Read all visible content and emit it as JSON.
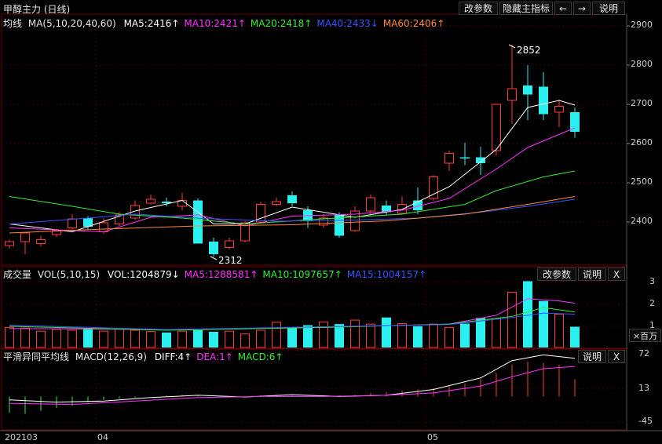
{
  "title": "甲醇主力 (日线)",
  "toolbar": {
    "params": "改参数",
    "hide_indicator": "隐藏主指标",
    "prev": "←",
    "next": "→",
    "help": "说明"
  },
  "panels": {
    "main": {
      "label": "均线",
      "formula": "MA(5,10,20,40,60)",
      "items": [
        {
          "text": "MA5:2416↑",
          "color": "#ffffff"
        },
        {
          "text": "MA10:2421↑",
          "color": "#ff33ff"
        },
        {
          "text": "MA20:2418↑",
          "color": "#33ee33"
        },
        {
          "text": "MA40:2433↓",
          "color": "#3355ff"
        },
        {
          "text": "MA60:2406↑",
          "color": "#ff8833"
        }
      ]
    },
    "volume": {
      "label": "成交量",
      "formula": "VOL(5,10,15)",
      "items": [
        {
          "text": "VOL:1204879↓",
          "color": "#ffffff"
        },
        {
          "text": "MA5:1288581↑",
          "color": "#ff33ff"
        },
        {
          "text": "MA10:1097657↑",
          "color": "#33ee33"
        },
        {
          "text": "MA15:1004157↑",
          "color": "#3355ff"
        }
      ],
      "params": "改参数",
      "help": "说明",
      "close": "X",
      "unit": "×百万"
    },
    "macd": {
      "label": "平滑异同平均线",
      "formula": "MACD(12,26,9)",
      "items": [
        {
          "text": "DIFF:4↑",
          "color": "#ffffff"
        },
        {
          "text": "DEA:1↑",
          "color": "#ff33ff"
        },
        {
          "text": "MACD:6↑",
          "color": "#33ee33"
        }
      ],
      "help": "说明",
      "close": "X"
    }
  },
  "chart_data": {
    "type": "candlestick",
    "title": "甲醇主力 (日线)",
    "price_axis": {
      "ticks": [
        2900,
        2800,
        2700,
        2600,
        2500,
        2400
      ]
    },
    "volume_axis": {
      "ticks": [
        3,
        2,
        1
      ],
      "unit": "×百万"
    },
    "macd_axis": {
      "ticks": [
        72,
        13,
        -45
      ]
    },
    "x_labels": [
      {
        "text": "202103",
        "index": 0
      },
      {
        "text": "04",
        "index": 6
      },
      {
        "text": "05",
        "index": 27
      }
    ],
    "annotations": [
      {
        "text": "2852",
        "index": 32,
        "value": 2852
      },
      {
        "text": "2312",
        "index": 13,
        "value": 2312
      }
    ],
    "candles": [
      {
        "o": 2340,
        "h": 2355,
        "l": 2332,
        "c": 2350
      },
      {
        "o": 2350,
        "h": 2375,
        "l": 2318,
        "c": 2372
      },
      {
        "o": 2345,
        "h": 2365,
        "l": 2338,
        "c": 2355
      },
      {
        "o": 2368,
        "h": 2382,
        "l": 2362,
        "c": 2378
      },
      {
        "o": 2385,
        "h": 2420,
        "l": 2380,
        "c": 2408
      },
      {
        "o": 2410,
        "h": 2415,
        "l": 2380,
        "c": 2388
      },
      {
        "o": 2375,
        "h": 2410,
        "l": 2370,
        "c": 2398
      },
      {
        "o": 2395,
        "h": 2425,
        "l": 2390,
        "c": 2418
      },
      {
        "o": 2410,
        "h": 2455,
        "l": 2405,
        "c": 2442
      },
      {
        "o": 2448,
        "h": 2470,
        "l": 2445,
        "c": 2458
      },
      {
        "o": 2452,
        "h": 2462,
        "l": 2440,
        "c": 2448
      },
      {
        "o": 2440,
        "h": 2475,
        "l": 2430,
        "c": 2455
      },
      {
        "o": 2455,
        "h": 2460,
        "l": 2345,
        "c": 2345
      },
      {
        "o": 2350,
        "h": 2360,
        "l": 2312,
        "c": 2318
      },
      {
        "o": 2335,
        "h": 2360,
        "l": 2330,
        "c": 2352
      },
      {
        "o": 2352,
        "h": 2402,
        "l": 2348,
        "c": 2398
      },
      {
        "o": 2400,
        "h": 2452,
        "l": 2395,
        "c": 2445
      },
      {
        "o": 2445,
        "h": 2462,
        "l": 2440,
        "c": 2452
      },
      {
        "o": 2468,
        "h": 2478,
        "l": 2440,
        "c": 2448
      },
      {
        "o": 2430,
        "h": 2440,
        "l": 2385,
        "c": 2402
      },
      {
        "o": 2392,
        "h": 2420,
        "l": 2385,
        "c": 2410
      },
      {
        "o": 2418,
        "h": 2425,
        "l": 2360,
        "c": 2365
      },
      {
        "o": 2378,
        "h": 2440,
        "l": 2375,
        "c": 2428
      },
      {
        "o": 2428,
        "h": 2470,
        "l": 2420,
        "c": 2462
      },
      {
        "o": 2442,
        "h": 2455,
        "l": 2418,
        "c": 2425
      },
      {
        "o": 2422,
        "h": 2465,
        "l": 2420,
        "c": 2445
      },
      {
        "o": 2455,
        "h": 2488,
        "l": 2420,
        "c": 2430
      },
      {
        "o": 2460,
        "h": 2520,
        "l": 2455,
        "c": 2515
      },
      {
        "o": 2550,
        "h": 2582,
        "l": 2530,
        "c": 2575
      },
      {
        "o": 2565,
        "h": 2602,
        "l": 2545,
        "c": 2562
      },
      {
        "o": 2565,
        "h": 2592,
        "l": 2520,
        "c": 2550
      },
      {
        "o": 2582,
        "h": 2702,
        "l": 2570,
        "c": 2700
      },
      {
        "o": 2710,
        "h": 2852,
        "l": 2650,
        "c": 2740
      },
      {
        "o": 2748,
        "h": 2800,
        "l": 2660,
        "c": 2725
      },
      {
        "o": 2745,
        "h": 2782,
        "l": 2660,
        "c": 2675
      },
      {
        "o": 2680,
        "h": 2712,
        "l": 2642,
        "c": 2695
      },
      {
        "o": 2680,
        "h": 2692,
        "l": 2615,
        "c": 2630
      }
    ],
    "ma": [
      {
        "name": "MA5",
        "color": "#ffffff",
        "points": [
          [
            0,
            2395
          ],
          [
            4,
            2375
          ],
          [
            8,
            2428
          ],
          [
            11,
            2455
          ],
          [
            13,
            2395
          ],
          [
            15,
            2395
          ],
          [
            18,
            2438
          ],
          [
            22,
            2412
          ],
          [
            25,
            2432
          ],
          [
            28,
            2490
          ],
          [
            31,
            2585
          ],
          [
            33,
            2692
          ],
          [
            35,
            2710
          ],
          [
            36,
            2698
          ]
        ]
      },
      {
        "name": "MA10",
        "color": "#ff33ff",
        "points": [
          [
            0,
            2385
          ],
          [
            6,
            2375
          ],
          [
            9,
            2412
          ],
          [
            12,
            2418
          ],
          [
            15,
            2390
          ],
          [
            18,
            2415
          ],
          [
            22,
            2420
          ],
          [
            25,
            2430
          ],
          [
            28,
            2460
          ],
          [
            31,
            2535
          ],
          [
            33,
            2590
          ],
          [
            36,
            2640
          ]
        ]
      },
      {
        "name": "MA20",
        "color": "#33ee33",
        "points": [
          [
            0,
            2465
          ],
          [
            4,
            2440
          ],
          [
            7,
            2420
          ],
          [
            11,
            2410
          ],
          [
            15,
            2395
          ],
          [
            20,
            2408
          ],
          [
            25,
            2420
          ],
          [
            29,
            2445
          ],
          [
            31,
            2480
          ],
          [
            34,
            2515
          ],
          [
            36,
            2530
          ]
        ]
      },
      {
        "name": "MA40",
        "color": "#3355ff",
        "points": [
          [
            0,
            2395
          ],
          [
            5,
            2410
          ],
          [
            8,
            2420
          ],
          [
            12,
            2410
          ],
          [
            17,
            2402
          ],
          [
            22,
            2405
          ],
          [
            26,
            2410
          ],
          [
            30,
            2425
          ],
          [
            33,
            2440
          ],
          [
            36,
            2458
          ]
        ]
      },
      {
        "name": "MA60",
        "color": "#ff8833",
        "points": [
          [
            0,
            2372
          ],
          [
            6,
            2382
          ],
          [
            12,
            2390
          ],
          [
            18,
            2393
          ],
          [
            24,
            2403
          ],
          [
            29,
            2420
          ],
          [
            33,
            2445
          ],
          [
            36,
            2465
          ]
        ]
      }
    ],
    "volume": [
      0.95,
      0.92,
      0.78,
      0.86,
      0.82,
      0.88,
      0.78,
      0.88,
      0.82,
      0.76,
      0.72,
      0.78,
      0.82,
      0.75,
      0.78,
      0.65,
      0.82,
      1.18,
      0.92,
      1.05,
      1.2,
      1.1,
      1.28,
      1.1,
      1.4,
      1.12,
      1.0,
      1.1,
      0.95,
      1.12,
      1.38,
      1.35,
      2.55,
      3.05,
      2.15,
      1.55,
      0.98
    ],
    "volume_ma": [
      {
        "name": "MA5",
        "color": "#ff33ff",
        "points": [
          [
            0,
            0.9
          ],
          [
            10,
            0.85
          ],
          [
            20,
            0.95
          ],
          [
            28,
            1.1
          ],
          [
            31,
            1.5
          ],
          [
            33,
            2.25
          ],
          [
            35,
            2.15
          ],
          [
            36,
            2.05
          ]
        ]
      },
      {
        "name": "MA10",
        "color": "#33ee33",
        "points": [
          [
            0,
            1.0
          ],
          [
            10,
            0.82
          ],
          [
            20,
            0.95
          ],
          [
            28,
            1.1
          ],
          [
            32,
            1.45
          ],
          [
            34,
            1.85
          ],
          [
            36,
            1.65
          ]
        ]
      },
      {
        "name": "MA15",
        "color": "#3355ff",
        "points": [
          [
            0,
            1.05
          ],
          [
            10,
            0.85
          ],
          [
            20,
            0.98
          ],
          [
            28,
            1.08
          ],
          [
            32,
            1.4
          ],
          [
            34,
            1.6
          ],
          [
            36,
            1.55
          ]
        ]
      }
    ],
    "macd": {
      "bars": [
        -28,
        -30,
        -25,
        -20,
        -16,
        -10,
        -6,
        -4,
        -2,
        0,
        2,
        3,
        2,
        0,
        -2,
        0,
        2,
        3,
        2,
        0,
        1,
        2,
        3,
        6,
        8,
        10,
        12,
        14,
        18,
        22,
        30,
        40,
        55,
        60,
        58,
        55,
        30
      ],
      "dif": [
        [
          0,
          -6
        ],
        [
          3,
          -10
        ],
        [
          6,
          -8
        ],
        [
          9,
          -2
        ],
        [
          12,
          2
        ],
        [
          15,
          -1
        ],
        [
          18,
          3
        ],
        [
          21,
          0
        ],
        [
          24,
          2
        ],
        [
          27,
          12
        ],
        [
          30,
          32
        ],
        [
          32,
          62
        ],
        [
          34,
          72
        ],
        [
          36,
          66
        ]
      ],
      "dea": [
        [
          0,
          -12
        ],
        [
          4,
          -14
        ],
        [
          8,
          -8
        ],
        [
          12,
          -2
        ],
        [
          16,
          0
        ],
        [
          20,
          0
        ],
        [
          24,
          2
        ],
        [
          27,
          6
        ],
        [
          30,
          18
        ],
        [
          32,
          34
        ],
        [
          34,
          48
        ],
        [
          36,
          52
        ]
      ]
    }
  }
}
